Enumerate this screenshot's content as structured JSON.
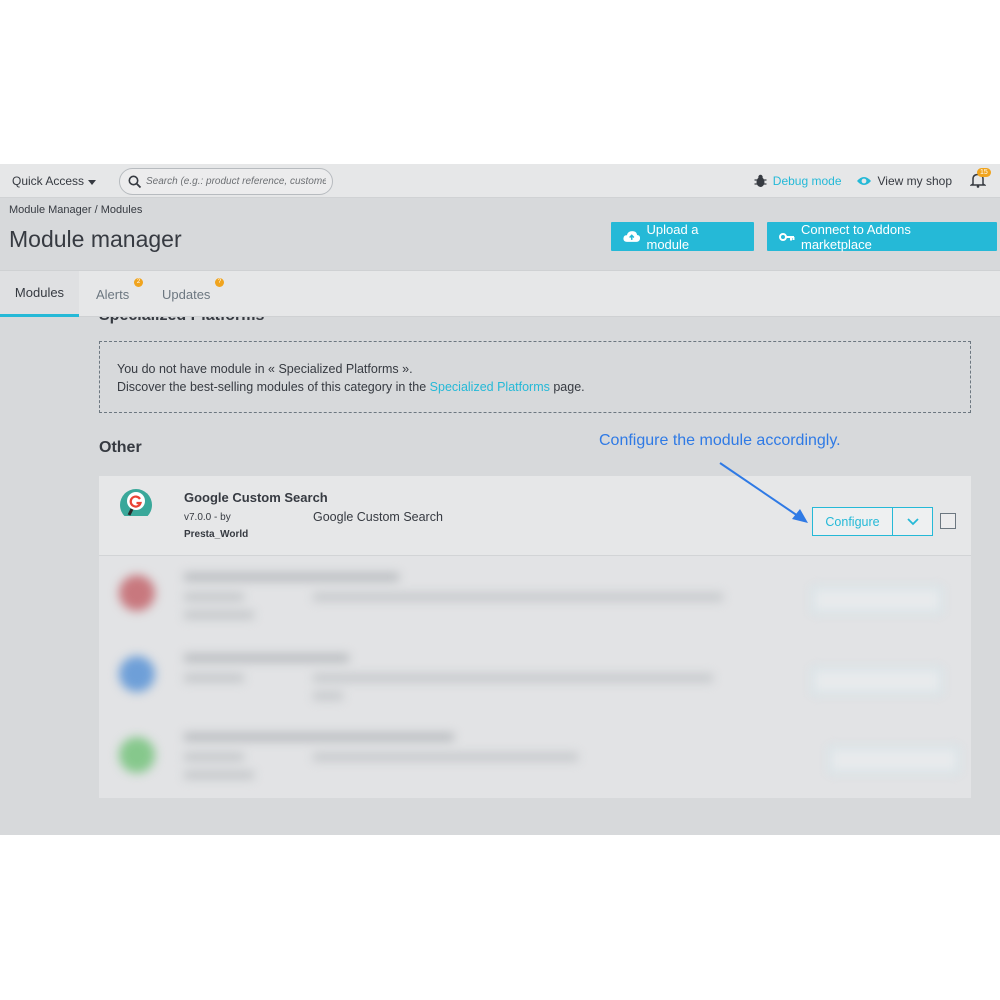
{
  "topbar": {
    "quick_access": "Quick Access",
    "search_placeholder": "Search (e.g.: product reference, custome",
    "debug_mode": "Debug mode",
    "view_shop": "View my shop",
    "notif_count": "15"
  },
  "breadcrumb": {
    "root": "Module Manager",
    "separator": "/",
    "current": "Modules"
  },
  "page_title": "Module manager",
  "header_buttons": {
    "upload": "Upload a module",
    "connect": "Connect to Addons marketplace"
  },
  "tabs": [
    {
      "label": "Modules",
      "active": true
    },
    {
      "label": "Alerts",
      "badge": "2"
    },
    {
      "label": "Updates",
      "badge": "?"
    }
  ],
  "cut_heading": "Specialized Platforms",
  "empty_notice": {
    "line1": "You do not have module in « Specialized Platforms ».",
    "line2_prefix": "Discover the best-selling modules of this category in the",
    "link": "Specialized Platforms",
    "line2_suffix": "page."
  },
  "section_title": "Other",
  "annotation": "Configure the module accordingly.",
  "module": {
    "name": "Google Custom Search",
    "version": "v7.0.0 - by",
    "author": "Presta_World",
    "description": "Google Custom Search",
    "configure": "Configure"
  },
  "colors": {
    "accent": "#25b9d7",
    "warning": "#f0a41e",
    "annotation": "#2f7ae5"
  }
}
